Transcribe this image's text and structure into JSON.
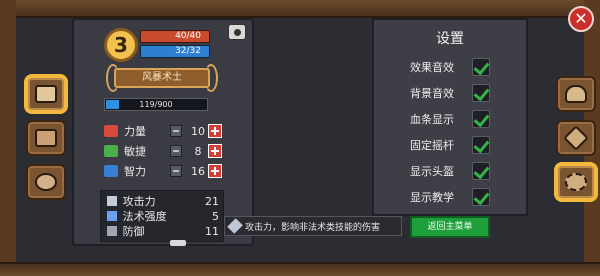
{
  "character": {
    "level": "3",
    "hp": "40/40",
    "mp": "32/32",
    "title": "风暴术士",
    "exp_text": "119/900",
    "exp_fraction": 0.132
  },
  "attributes": [
    {
      "label": "力量",
      "value": "10",
      "color": "#d64b3c"
    },
    {
      "label": "敏捷",
      "value": "8",
      "color": "#4bb04a"
    },
    {
      "label": "智力",
      "value": "16",
      "color": "#3a7fd6"
    }
  ],
  "stats": [
    {
      "label": "攻击力",
      "value": "21",
      "color": "#c3ccd8"
    },
    {
      "label": "法术强度",
      "value": "5",
      "color": "#6f9ff0"
    },
    {
      "label": "防御",
      "value": "11",
      "color": "#9fa6b2"
    }
  ],
  "tooltip": {
    "text": "攻击力，影响非法术类技能的伤害"
  },
  "settings": {
    "title": "设置",
    "items": [
      {
        "label": "效果音效",
        "checked": true
      },
      {
        "label": "背景音效",
        "checked": true
      },
      {
        "label": "血条显示",
        "checked": true
      },
      {
        "label": "固定摇杆",
        "checked": true
      },
      {
        "label": "显示头盔",
        "checked": true
      },
      {
        "label": "显示教学",
        "checked": true
      }
    ],
    "main_menu_label": "返回主菜单"
  },
  "icons": {
    "close": "close-icon",
    "camera": "camera-icon",
    "left_tabs": [
      "book-icon",
      "chest-icon",
      "people-icon"
    ],
    "right_tabs": [
      "helmet-icon",
      "tools-icon",
      "gear-icon"
    ]
  }
}
